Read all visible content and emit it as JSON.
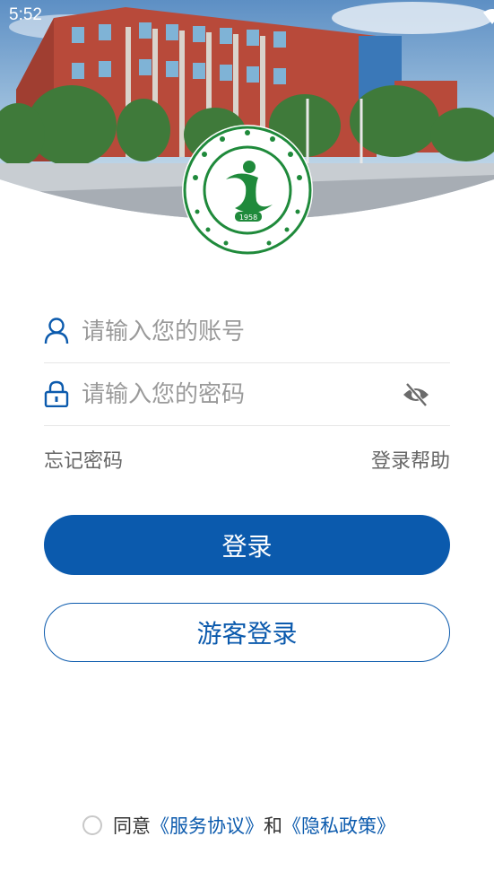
{
  "status_bar": {
    "time": "5:52"
  },
  "logo": {
    "year": "1958"
  },
  "form": {
    "account_placeholder": "请输入您的账号",
    "password_placeholder": "请输入您的密码",
    "forgot_password": "忘记密码",
    "login_help": "登录帮助"
  },
  "buttons": {
    "login": "登录",
    "guest_login": "游客登录"
  },
  "agreement": {
    "prefix": "同意",
    "service": "《服务协议》",
    "and": "和",
    "privacy": "《隐私政策》"
  },
  "colors": {
    "primary": "#0b5aad",
    "logo_green": "#1f8a3b"
  }
}
